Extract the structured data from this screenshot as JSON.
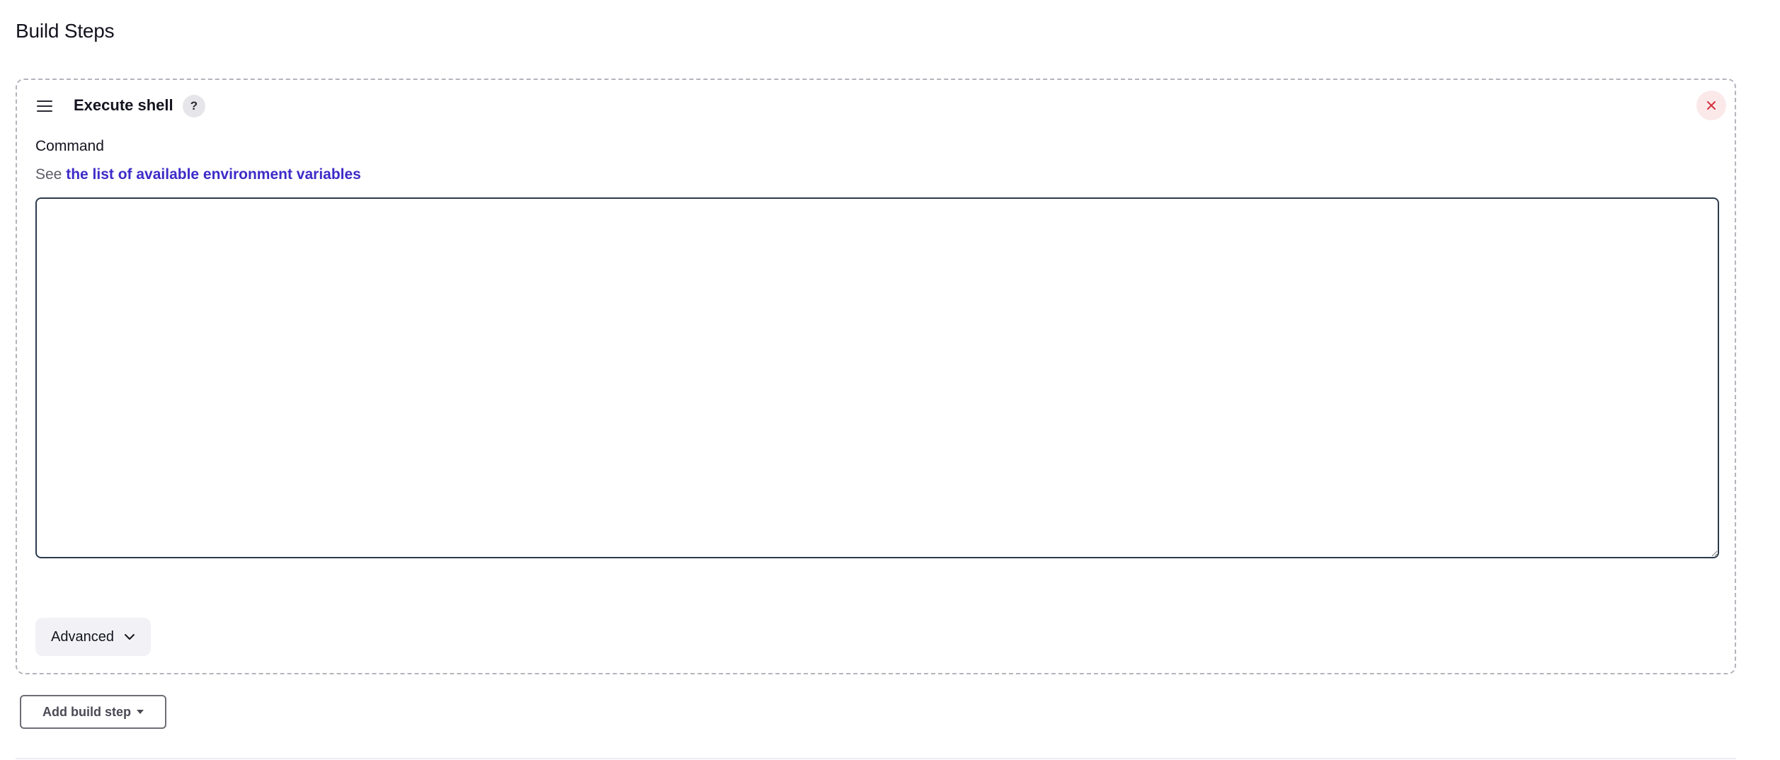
{
  "section": {
    "title": "Build Steps"
  },
  "step": {
    "title": "Execute shell",
    "help_label": "?",
    "command": {
      "label": "Command",
      "description_prefix": "See ",
      "link_text": "the list of available environment variables",
      "value": ""
    },
    "advanced_label": "Advanced"
  },
  "add_step": {
    "label": "Add build step"
  },
  "colors": {
    "link": "#3d2bc8",
    "close": "#d42e3a",
    "close_bg": "#fbe9ea",
    "textarea_border": "#2c3b4d"
  },
  "icons": {
    "drag": "hamburger-menu",
    "close": "x-mark",
    "advanced": "chevron-down",
    "add_step": "caret-down"
  }
}
